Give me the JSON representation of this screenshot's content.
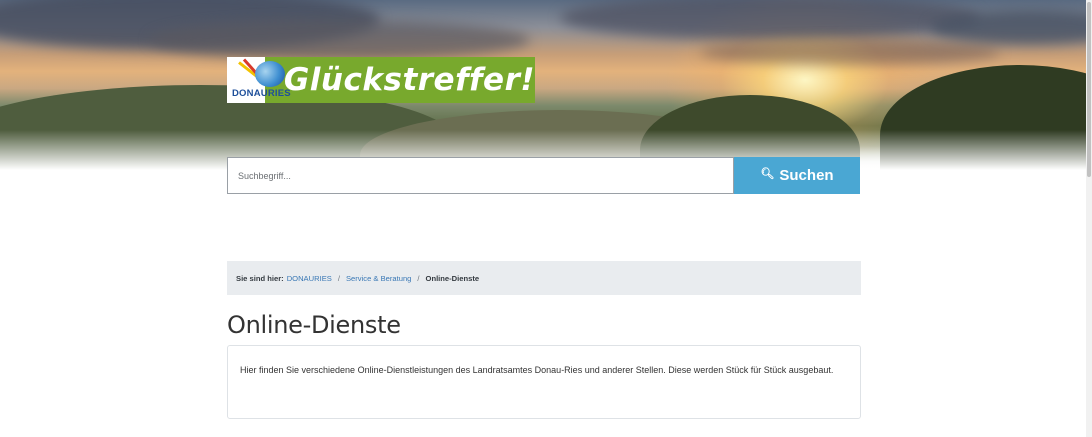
{
  "logo": {
    "brand": "DONAURIES",
    "claim": "Glückstreffer!"
  },
  "search": {
    "placeholder": "Suchbegriff...",
    "button_label": "Suchen",
    "button_icon": "search-icon"
  },
  "breadcrumb": {
    "label": "Sie sind hier:",
    "items": [
      "DONAURIES",
      "Service & Beratung"
    ],
    "current": "Online-Dienste",
    "separator": "/"
  },
  "page": {
    "title": "Online-Dienste",
    "intro": "Hier finden Sie verschiedene Online-Dienstleistungen des Landratsamtes Donau-Ries und anderer Stellen. Diese werden Stück für Stück ausgebaut."
  },
  "colors": {
    "claim_green": "#78a92d",
    "search_blue": "#4aa7d3",
    "link_blue": "#3a78b5",
    "breadcrumb_bg": "#e9ecef"
  }
}
